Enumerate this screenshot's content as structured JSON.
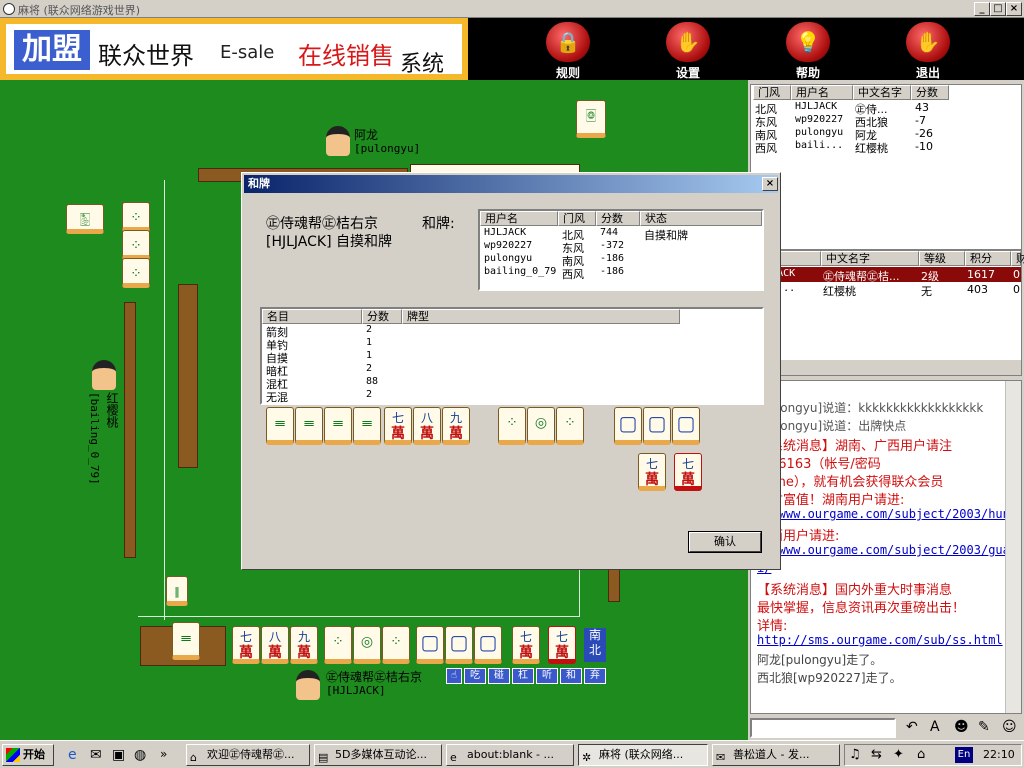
{
  "window": {
    "title": "麻将 (联众网络游戏世界)"
  },
  "banner": {
    "join": "加盟",
    "brand": "联众世界",
    "esale": "E-sale",
    "online": "在线销售",
    "system": "系统"
  },
  "toolbar": {
    "rules": "规则",
    "settings": "设置",
    "help": "帮助",
    "exit": "退出"
  },
  "players": {
    "top": {
      "name": "阿龙",
      "user": "[pulongyu]"
    },
    "left": {
      "name": "红樱桃",
      "user": "[bailing_0_79]"
    },
    "bottom": {
      "name": "㊣侍魂帮㊣桔右京",
      "user": "[HJLJACK]"
    }
  },
  "score_panel": {
    "headers": [
      "门风",
      "用户名",
      "中文名字",
      "分数"
    ],
    "rows": [
      [
        "北风",
        "HJLJACK",
        "㊣侍...",
        "43"
      ],
      [
        "东风",
        "wp920227",
        "西北狼",
        "-7"
      ],
      [
        "南风",
        "pulongyu",
        "阿龙",
        "-26"
      ],
      [
        "西风",
        "baili...",
        "红樱桃",
        "-10"
      ]
    ]
  },
  "user_panel": {
    "headers": [
      "名",
      "中文名字",
      "等级",
      "积分",
      "财"
    ],
    "rows": [
      [
        "HJLJACK",
        "㊣侍魂帮㊣桔...",
        "2级",
        "1617",
        "0"
      ],
      [
        "bail...",
        "红樱桃",
        "无",
        "403",
        "0"
      ]
    ]
  },
  "chat": {
    "lines": [
      {
        "text": "[pulongyu]说道：kkkkkkkkkkkkkkkkkk",
        "color": "#555555"
      },
      {
        "text": "[pulongyu]说道：出牌快点",
        "color": "#555555"
      },
      {
        "text": "【系统消息】湖南、广西用户请注",
        "color": "#d01010"
      },
      {
        "text": "拨96163（帐号/密码",
        "color": "#d01010"
      },
      {
        "text": "game），就有机会获得联众会员",
        "color": "#d01010"
      },
      {
        "text": "和财富值！湖南用户请进:",
        "color": "#d01010"
      },
      {
        "text": "://www.ourgame.com/subject/2003/huna",
        "color": "#0000cc",
        "link": true
      },
      {
        "text": "广西用户请进:",
        "color": "#d01010"
      },
      {
        "text": "://www.ourgame.com/subject/2003/guan",
        "color": "#0000cc",
        "link": true
      },
      {
        "text": "i/",
        "color": "#0000cc",
        "link": true
      },
      {
        "text": "【系统消息】国内外重大时事消息",
        "color": "#d01010"
      },
      {
        "text": "最快掌握，信息资讯再次重磅出击！",
        "color": "#d01010"
      },
      {
        "text": "详情:",
        "color": "#d01010"
      },
      {
        "text": "http://sms.ourgame.com/sub/ss.html",
        "color": "#0000cc",
        "link": true
      },
      {
        "text": "阿龙[pulongyu]走了。",
        "color": "#444444"
      },
      {
        "text": "西北狼[wp920227]走了。",
        "color": "#444444"
      }
    ]
  },
  "dialog": {
    "title": "和牌",
    "winner_line1": "㊣侍魂帮㊣桔右京",
    "winner_line2": "[HJLJACK] 自摸和牌",
    "he_label": "和牌:",
    "result_headers": [
      "用户名",
      "门风",
      "分数",
      "状态"
    ],
    "results": [
      [
        "HJLJACK",
        "北风",
        "744",
        "自摸和牌"
      ],
      [
        "wp920227",
        "东风",
        "-372",
        ""
      ],
      [
        "pulongyu",
        "南风",
        "-186",
        ""
      ],
      [
        "bailing_0_79",
        "西风",
        "-186",
        ""
      ]
    ],
    "fan_headers": [
      "名目",
      "分数",
      "牌型"
    ],
    "fans": [
      [
        "箭刻",
        "2"
      ],
      [
        "单钓",
        "1"
      ],
      [
        "自摸",
        "1"
      ],
      [
        "暗杠",
        "2"
      ],
      [
        "混杠",
        "88"
      ],
      [
        "无混",
        "2"
      ]
    ],
    "ok": "确认"
  },
  "tiles": {
    "wan7": [
      "七",
      "萬"
    ],
    "wan8": [
      "八",
      "萬"
    ],
    "wan9": [
      "九",
      "萬"
    ],
    "hongzhong": "中",
    "nanbei": [
      "南",
      "北"
    ]
  },
  "action_buttons": [
    "吃",
    "碰",
    "杠",
    "听",
    "和",
    "弃"
  ],
  "taskbar": {
    "start": "开始",
    "tasks": [
      "欢迎㊣侍魂帮㊣...",
      "5D多媒体互动论...",
      "about:blank - ...",
      "麻将 (联众网络...",
      "善松道人 - 发..."
    ],
    "lang": "En",
    "time": "22:10"
  }
}
